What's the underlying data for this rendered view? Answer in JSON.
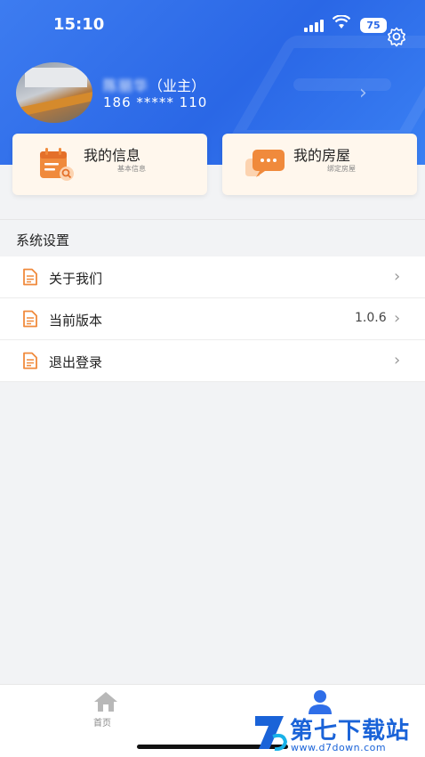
{
  "status_bar": {
    "time": "15:10",
    "battery": "75"
  },
  "profile": {
    "name_blurred": "陈丽华",
    "role": "（业主）",
    "phone": "186 ***** 110"
  },
  "cards": [
    {
      "title": "我的信息",
      "subtitle": "基本信息"
    },
    {
      "title": "我的房屋",
      "subtitle": "绑定房屋"
    }
  ],
  "section": {
    "title": "系统设置"
  },
  "menu": [
    {
      "label": "关于我们",
      "value": ""
    },
    {
      "label": "当前版本",
      "value": "1.0.6"
    },
    {
      "label": "退出登录",
      "value": ""
    }
  ],
  "tabbar": {
    "home_label": "首页"
  },
  "watermark": {
    "brand": "第七下载站",
    "url": "www.d7down.com"
  },
  "colors": {
    "header_blue": "#2a67e6",
    "card_bg": "#fff7ed",
    "icon_orange": "#f08a3c",
    "tab_active": "#2f6ee8"
  }
}
